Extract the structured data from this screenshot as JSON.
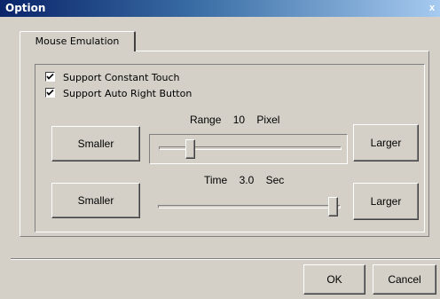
{
  "window": {
    "title": "Option"
  },
  "tabs": [
    {
      "label": "Mouse Emulation"
    }
  ],
  "options": {
    "support_constant_touch": {
      "label": "Support Constant Touch",
      "checked": true
    },
    "support_auto_right_button": {
      "label": "Support Auto Right Button",
      "checked": true
    }
  },
  "range": {
    "label": "Range",
    "value": "10",
    "unit": "Pixel",
    "smaller_label": "Smaller",
    "larger_label": "Larger",
    "position_fraction": 0.1
  },
  "time": {
    "label": "Time",
    "value": "3.0",
    "unit": "Sec",
    "smaller_label": "Smaller",
    "larger_label": "Larger",
    "position_fraction": 1.0
  },
  "footer": {
    "ok_label": "OK",
    "cancel_label": "Cancel"
  },
  "colors": {
    "titlebar_start": "#0a246a",
    "titlebar_end": "#a6caf0",
    "face": "#d4d0c8"
  }
}
